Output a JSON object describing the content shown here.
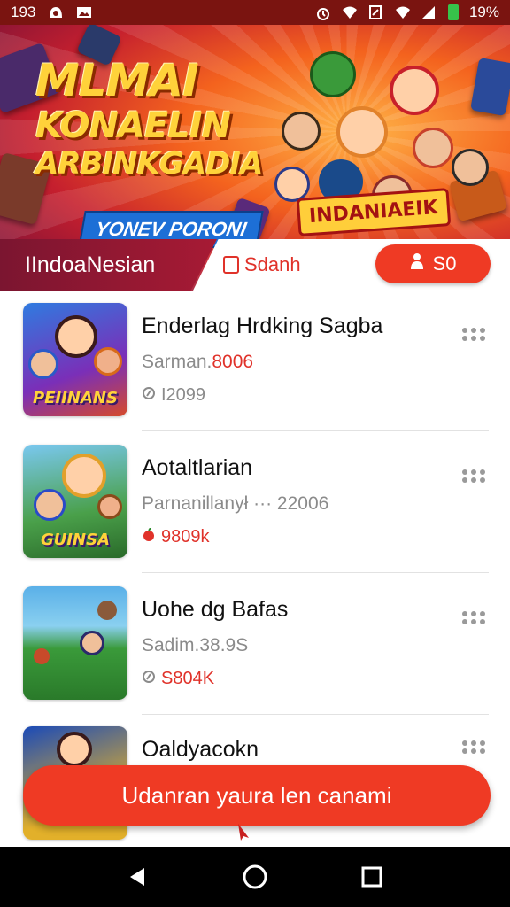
{
  "status_bar": {
    "time": "193",
    "battery": "19%",
    "icons": [
      "notification-icon",
      "image-icon",
      "alarm-icon",
      "wifi-icon",
      "nfc-icon",
      "signal-icon",
      "signal-icon",
      "battery-icon"
    ]
  },
  "banner": {
    "title_line1": "MLMAI",
    "title_line2": "KONAELIN",
    "title_line3": "ARBINKGADIA",
    "tagline": "YONEV PORONI",
    "badge": "INDANIAEIK"
  },
  "tabs": {
    "active_label": "IIndoaNesian",
    "search_label": "Sdanh",
    "pill_label": "S0"
  },
  "apps": [
    {
      "name": "Enderlag Hrdking Sagba",
      "meta_prefix": "Sarman.",
      "meta_highlight": "8006",
      "stat": "I2099",
      "stat_red": false,
      "thumb_label": "PEIINANS"
    },
    {
      "name": "Aotaltlarian",
      "meta_prefix": "Parnanillanył",
      "meta_suffix": "···  22006",
      "stat": "9809k",
      "stat_red": true,
      "thumb_label": "GUINSA"
    },
    {
      "name": "Uohe dg Bafas",
      "meta_prefix": "Sadim.38.9S",
      "stat": "S804K",
      "stat_red": true,
      "thumb_label": ""
    },
    {
      "name": "Oaldyacokn",
      "meta_prefix": "",
      "stat": "",
      "stat_red": false,
      "thumb_label": ""
    }
  ],
  "cta": {
    "label": "Udanran yaura len canami"
  },
  "nav": {
    "back": "back-icon",
    "home": "home-icon",
    "recents": "recents-icon"
  },
  "colors": {
    "accent": "#ef3a24",
    "status_bar": "#7a1410",
    "tab_active": "#a71a34",
    "yellow": "#ffd23a"
  }
}
